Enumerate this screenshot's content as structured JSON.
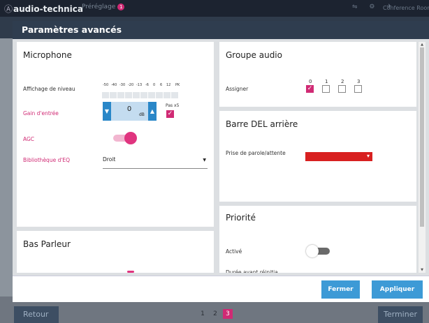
{
  "topbar": {
    "logo_glyph": "Ⓐ",
    "brand": "audio-technica",
    "preset_label": "Préréglage",
    "preset_badge": "1",
    "status_icons": "⇋ ⚙ ✈",
    "room_label": "Conference Room"
  },
  "modal": {
    "title": "Paramètres avancés",
    "close_label": "Fermer",
    "apply_label": "Appliquer"
  },
  "microphone": {
    "title": "Microphone",
    "level_label": "Affichage de niveau",
    "level_ticks": [
      "-50",
      "-40",
      "-30",
      "-20",
      "-13",
      "-6",
      "0",
      "6",
      "12",
      "PK"
    ],
    "gain_label": "Gain d'entrée",
    "gain_value": "0",
    "gain_unit": "dB",
    "pad_label": "Pas x5",
    "pad_checked": true,
    "agc_label": "AGC",
    "agc_on": true,
    "eq_label": "Bibliothèque d'EQ",
    "eq_value": "Droit"
  },
  "speaker": {
    "title": "Bas Parleur"
  },
  "audio_group": {
    "title": "Groupe audio",
    "assign_label": "Assigner",
    "options": [
      "0",
      "1",
      "2",
      "3"
    ],
    "selected_index": 0
  },
  "led_bar": {
    "title": "Barre DEL arrière",
    "talk_label": "Prise de parole/attente",
    "color": "#d82020"
  },
  "priority": {
    "title": "Priorité",
    "enabled_label": "Activé",
    "enabled_on": false,
    "next_label_partial": "Durée avant réinitia…"
  },
  "footer_nav": {
    "back_label": "Retour",
    "finish_label": "Terminer",
    "pages": [
      "1",
      "2",
      "3"
    ],
    "current_page": "3"
  },
  "colors": {
    "accent_pink": "#d02a74",
    "accent_blue": "#3d9ad6",
    "header_dark": "#2f3d4f"
  }
}
